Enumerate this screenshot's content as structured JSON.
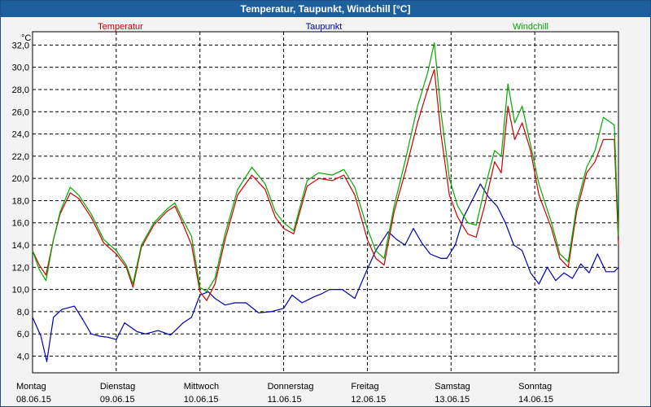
{
  "window": {
    "title": "Temperatur, Taupunkt, Windchill [°C]"
  },
  "colors": {
    "background": "#f3f3f3",
    "titlebar": "#1e5f9e",
    "temperatur": "#cc0000",
    "taupunkt": "#0000aa",
    "windchill": "#00aa00",
    "grid": "#000000"
  },
  "chart_data": {
    "type": "line",
    "title": "Temperatur, Taupunkt, Windchill [°C]",
    "ylabel": "°C",
    "ylim": [
      2.5,
      33.2
    ],
    "xlim": [
      0,
      7
    ],
    "grid": true,
    "legend_position": "top",
    "yticks": [
      4,
      6,
      8,
      10,
      12,
      14,
      16,
      18,
      20,
      22,
      24,
      26,
      28,
      30,
      32
    ],
    "ytick_labels": [
      "4,0",
      "6,0",
      "8,0",
      "10,0",
      "12,0",
      "14,0",
      "16,0",
      "18,0",
      "20,0",
      "22,0",
      "24,0",
      "26,0",
      "28,0",
      "30,0",
      "32,0"
    ],
    "x_day_labels": [
      {
        "day": "Montag",
        "date": "08.06.15"
      },
      {
        "day": "Dienstag",
        "date": "09.06.15"
      },
      {
        "day": "Mittwoch",
        "date": "10.06.15"
      },
      {
        "day": "Donnerstag",
        "date": "11.06.15"
      },
      {
        "day": "Freitag",
        "date": "12.06.15"
      },
      {
        "day": "Samstag",
        "date": "13.06.15"
      },
      {
        "day": "Sonntag",
        "date": "14.06.15"
      }
    ],
    "series": [
      {
        "name": "Temperatur",
        "color": "#cc0000",
        "x": [
          0,
          0.08,
          0.16,
          0.25,
          0.33,
          0.45,
          0.55,
          0.7,
          0.85,
          1.0,
          1.12,
          1.2,
          1.3,
          1.45,
          1.6,
          1.7,
          1.78,
          1.9,
          2.0,
          2.08,
          2.18,
          2.3,
          2.45,
          2.62,
          2.78,
          2.9,
          3.0,
          3.12,
          3.28,
          3.42,
          3.58,
          3.72,
          3.85,
          4.0,
          4.1,
          4.2,
          4.32,
          4.45,
          4.6,
          4.72,
          4.8,
          4.88,
          4.98,
          5.08,
          5.2,
          5.3,
          5.4,
          5.52,
          5.6,
          5.68,
          5.76,
          5.85,
          5.95,
          6.05,
          6.2,
          6.3,
          6.4,
          6.5,
          6.62,
          6.72,
          6.82,
          6.95,
          7.0
        ],
        "values": [
          13.5,
          12.2,
          11.3,
          14.5,
          16.8,
          18.7,
          18.2,
          16.5,
          14.2,
          13.2,
          12.0,
          10.2,
          13.8,
          15.8,
          17.0,
          17.5,
          16.2,
          14.0,
          9.8,
          9.0,
          10.5,
          14.5,
          18.5,
          20.3,
          19.0,
          16.5,
          15.5,
          15.0,
          19.3,
          20.0,
          19.8,
          20.3,
          18.5,
          14.5,
          12.8,
          12.2,
          17.0,
          20.5,
          25.0,
          28.0,
          29.8,
          24.0,
          18.5,
          16.5,
          15.0,
          14.7,
          17.5,
          21.5,
          20.5,
          26.5,
          23.5,
          25.0,
          22.5,
          18.5,
          15.5,
          12.8,
          12.0,
          17.0,
          20.5,
          21.5,
          23.5,
          23.5,
          14.0
        ]
      },
      {
        "name": "Taupunkt",
        "color": "#0000aa",
        "x": [
          0,
          0.1,
          0.17,
          0.25,
          0.35,
          0.5,
          0.6,
          0.7,
          0.8,
          0.9,
          1.0,
          1.1,
          1.25,
          1.35,
          1.5,
          1.65,
          1.8,
          1.9,
          2.0,
          2.1,
          2.18,
          2.3,
          2.42,
          2.55,
          2.7,
          2.85,
          3.0,
          3.1,
          3.22,
          3.35,
          3.45,
          3.55,
          3.7,
          3.85,
          3.98,
          4.1,
          4.25,
          4.35,
          4.45,
          4.55,
          4.65,
          4.75,
          4.88,
          4.95,
          5.05,
          5.15,
          5.25,
          5.35,
          5.45,
          5.55,
          5.65,
          5.75,
          5.85,
          5.95,
          6.05,
          6.15,
          6.25,
          6.35,
          6.45,
          6.55,
          6.65,
          6.75,
          6.85,
          6.95,
          7.0
        ],
        "values": [
          7.5,
          5.8,
          3.5,
          7.5,
          8.2,
          8.5,
          7.3,
          6.0,
          5.8,
          5.7,
          5.5,
          7.0,
          6.2,
          6.0,
          6.3,
          5.9,
          7.0,
          7.5,
          9.5,
          9.8,
          9.2,
          8.6,
          8.8,
          8.8,
          7.9,
          8.0,
          8.3,
          9.5,
          8.8,
          9.3,
          9.6,
          10.0,
          10.0,
          9.2,
          11.5,
          13.5,
          15.2,
          14.5,
          14.0,
          15.5,
          14.2,
          13.2,
          12.8,
          12.8,
          14.0,
          16.5,
          18.0,
          19.5,
          18.3,
          17.5,
          16.0,
          14.0,
          13.5,
          11.5,
          10.5,
          12.0,
          10.8,
          11.5,
          11.0,
          12.3,
          11.5,
          13.2,
          11.6,
          11.6,
          12.0
        ]
      },
      {
        "name": "Windchill",
        "color": "#00aa00",
        "x": [
          0,
          0.08,
          0.16,
          0.25,
          0.33,
          0.45,
          0.55,
          0.7,
          0.85,
          1.0,
          1.12,
          1.2,
          1.3,
          1.45,
          1.6,
          1.7,
          1.78,
          1.9,
          2.0,
          2.08,
          2.18,
          2.3,
          2.45,
          2.62,
          2.78,
          2.9,
          3.0,
          3.12,
          3.28,
          3.42,
          3.58,
          3.72,
          3.85,
          4.0,
          4.1,
          4.2,
          4.32,
          4.45,
          4.6,
          4.72,
          4.8,
          4.88,
          4.98,
          5.08,
          5.2,
          5.3,
          5.4,
          5.52,
          5.6,
          5.68,
          5.76,
          5.85,
          5.95,
          6.05,
          6.2,
          6.3,
          6.4,
          6.5,
          6.62,
          6.72,
          6.82,
          6.95,
          7.0
        ],
        "values": [
          13.5,
          11.8,
          10.8,
          14.5,
          17.0,
          19.2,
          18.5,
          16.8,
          14.5,
          13.5,
          12.2,
          10.5,
          14.0,
          16.0,
          17.2,
          17.8,
          16.5,
          14.8,
          10.2,
          9.8,
          11.0,
          15.0,
          19.0,
          21.0,
          19.5,
          17.0,
          16.0,
          15.3,
          19.8,
          20.5,
          20.3,
          20.8,
          19.2,
          15.5,
          13.5,
          12.8,
          17.5,
          21.5,
          26.5,
          29.5,
          32.2,
          26.0,
          20.0,
          17.5,
          16.0,
          15.8,
          19.0,
          22.5,
          22.0,
          28.5,
          25.0,
          26.5,
          23.0,
          19.5,
          16.0,
          13.2,
          12.5,
          17.5,
          21.0,
          22.5,
          25.5,
          24.8,
          14.8
        ]
      }
    ]
  }
}
